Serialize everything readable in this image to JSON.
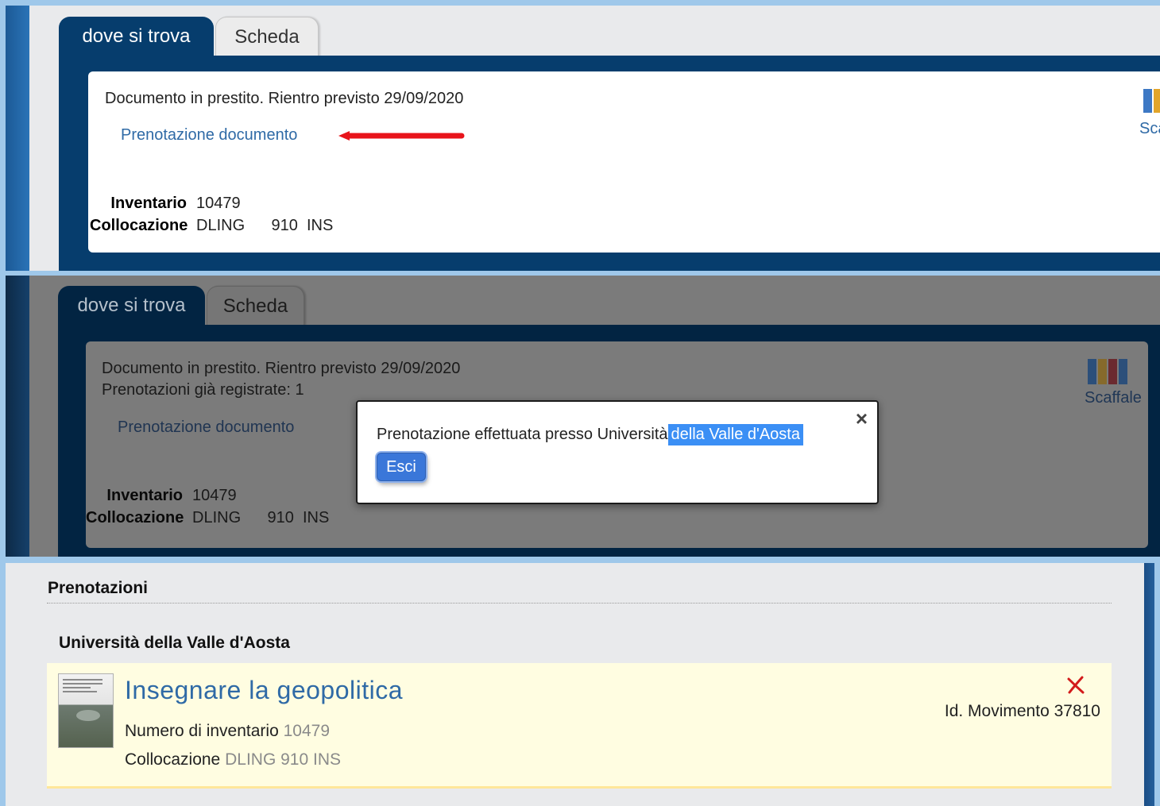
{
  "panel1": {
    "tabs": [
      "dove si trova",
      "Scheda"
    ],
    "status": "Documento in prestito. Rientro previsto 29/09/2020",
    "reserve_link": "Prenotazione documento",
    "inventory_label": "Inventario",
    "inventory_value": "10479",
    "location_label": "Collocazione",
    "location_value": "DLING      910  INS",
    "shelf_label_partial": "Sca",
    "arrow_color": "#e8141b"
  },
  "panel2": {
    "tabs": [
      "dove si trova",
      "Scheda"
    ],
    "status": "Documento in prestito. Rientro previsto 29/09/2020",
    "existing_reservations": "Prenotazioni già registrate: 1",
    "reserve_link": "Prenotazione documento",
    "inventory_label": "Inventario",
    "inventory_value": "10479",
    "location_label": "Collocazione",
    "location_value": "DLING      910  INS",
    "shelf_label": "Scaffale"
  },
  "modal": {
    "message_prefix": "Prenotazione effettuata presso Università",
    "message_selected": "della Valle d'Aosta",
    "close_glyph": "×",
    "exit_label": "Esci",
    "selection_color": "#3b8ff5"
  },
  "reservations": {
    "section_title": "Prenotazioni",
    "library": "Università della Valle d'Aosta",
    "item": {
      "title": "Insegnare la geopolitica",
      "inventory_label": "Numero di inventario",
      "inventory_value": "10479",
      "location_label": "Collocazione",
      "location_value": "DLING 910 INS",
      "movement_label": "Id. Movimento",
      "movement_value": "37810"
    }
  },
  "icons": {
    "shelf": "shelf-books-icon",
    "delete": "delete-x-icon",
    "close": "close-icon"
  }
}
